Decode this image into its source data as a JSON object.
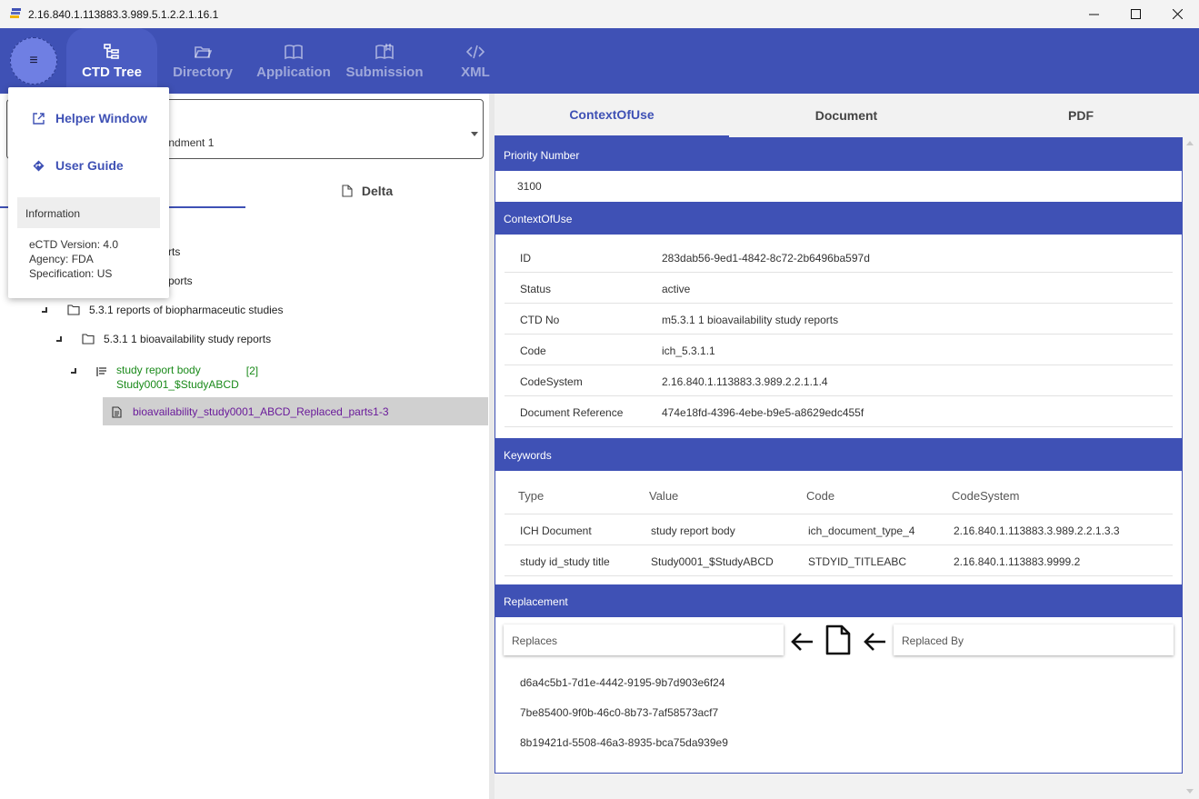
{
  "window": {
    "title": "2.16.840.1.113883.3.989.5.1.2.2.1.16.1"
  },
  "nav": {
    "menu_glyph": "≡",
    "tabs": [
      {
        "label": "CTD Tree",
        "icon": "tree-icon"
      },
      {
        "label": "Directory",
        "icon": "folder-open-icon"
      },
      {
        "label": "Application",
        "icon": "book-icon"
      },
      {
        "label": "Submission",
        "icon": "submission-book-icon"
      },
      {
        "label": "XML",
        "icon": "code-icon"
      }
    ]
  },
  "menu": {
    "helper_window": "Helper Window",
    "user_guide": "User Guide",
    "info_header": "Information",
    "ectd_version": "eCTD Version: 4.0",
    "agency": "Agency: FDA",
    "specification": "Specification: US"
  },
  "left": {
    "select_value_partial": "nendment 1",
    "delta_tab": "Delta",
    "tree": {
      "row1_partial": "rts",
      "row2_partial": "ports",
      "row3": "5.3.1 reports of biopharmaceutic studies",
      "row4": "5.3.1 1 bioavailability study reports",
      "row5_line1": "study report body",
      "row5_line2": "Study0001_$StudyABCD",
      "row5_count": "[2]",
      "row6": "bioavailability_study0001_ABCD_Replaced_parts1-3"
    }
  },
  "right": {
    "tabs": [
      "ContextOfUse",
      "Document",
      "PDF"
    ],
    "priority": {
      "header": "Priority Number",
      "value": "3100"
    },
    "context": {
      "header": "ContextOfUse",
      "fields": [
        {
          "key": "ID",
          "value": "283dab56-9ed1-4842-8c72-2b6496ba597d"
        },
        {
          "key": "Status",
          "value": "active"
        },
        {
          "key": "CTD No",
          "value": "m5.3.1 1 bioavailability study reports"
        },
        {
          "key": "Code",
          "value": "ich_5.3.1.1"
        },
        {
          "key": "CodeSystem",
          "value": "2.16.840.1.113883.3.989.2.2.1.1.4"
        },
        {
          "key": "Document Reference",
          "value": "474e18fd-4396-4ebe-b9e5-a8629edc455f"
        }
      ]
    },
    "keywords": {
      "header": "Keywords",
      "columns": [
        "Type",
        "Value",
        "Code",
        "CodeSystem"
      ],
      "rows": [
        [
          "ICH Document",
          "study report body",
          "ich_document_type_4",
          "2.16.840.1.113883.3.989.2.2.1.3.3"
        ],
        [
          "study id_study title",
          "Study0001_$StudyABCD",
          "STDYID_TITLEABC",
          "2.16.840.1.113883.9999.2"
        ]
      ]
    },
    "replacement": {
      "header": "Replacement",
      "replaces_label": "Replaces",
      "replaced_by_label": "Replaced By",
      "ids": [
        "d6a4c5b1-7d1e-4442-9195-9b7d903e6f24",
        "7be85400-9f0b-46c0-8b73-7af58573acf7",
        "8b19421d-5508-46a3-8935-bca75da939e9"
      ]
    }
  }
}
